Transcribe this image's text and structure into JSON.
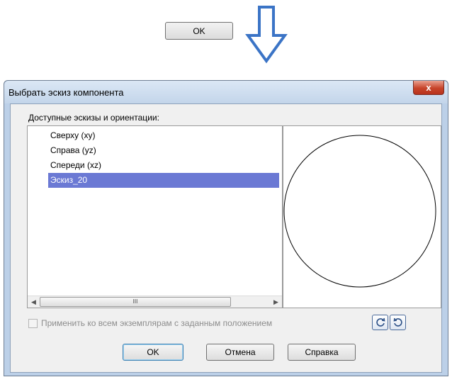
{
  "annotation": {
    "ok_label": "OK",
    "arrow_color": "#3b74c6"
  },
  "dialog": {
    "title": "Выбрать эскиз компонента",
    "close_label": "x",
    "group_label": "Доступные эскизы и ориентации:",
    "items": [
      {
        "label": "Сверху (xy)",
        "selected": false
      },
      {
        "label": "Справа (yz)",
        "selected": false
      },
      {
        "label": "Спереди (xz)",
        "selected": false
      },
      {
        "label": "Эскиз_20",
        "selected": true
      }
    ],
    "scroll_thumb_grip": "III",
    "checkbox_label": "Применить ко всем экземплярам с заданным положением",
    "checkbox_checked": false,
    "buttons": {
      "ok": "OK",
      "cancel": "Отмена",
      "help": "Справка"
    },
    "selection_color": "#6b79d4"
  }
}
